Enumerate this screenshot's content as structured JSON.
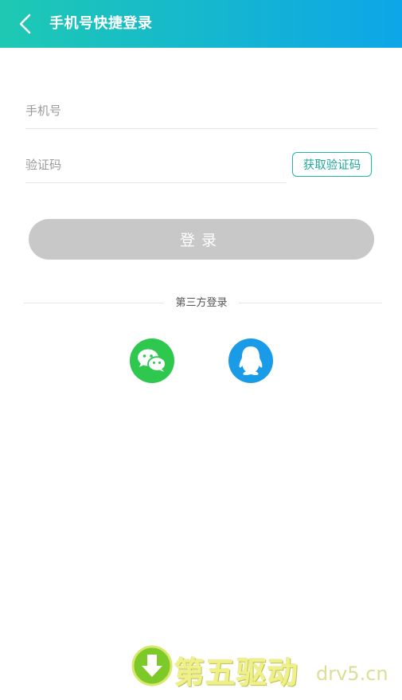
{
  "header": {
    "title": "手机号快捷登录",
    "back_icon": "chevron-left-icon"
  },
  "form": {
    "phone_placeholder": "手机号",
    "phone_value": "",
    "code_placeholder": "验证码",
    "code_value": "",
    "get_code_label": "获取验证码",
    "login_label": "登录"
  },
  "third_party": {
    "label": "第三方登录",
    "providers": [
      {
        "name": "wechat",
        "icon": "wechat-icon",
        "color": "#2dc84d"
      },
      {
        "name": "qq",
        "icon": "qq-icon",
        "color": "#1a9be8"
      }
    ]
  },
  "watermark": {
    "text": "第五驱动",
    "domain": "drv5.cn",
    "icon": "download-arrow-icon"
  },
  "colors": {
    "header_start": "#1ec9b3",
    "header_end": "#0da6e8",
    "accent": "#1fb8a6",
    "login_disabled": "#c8c8c8"
  }
}
